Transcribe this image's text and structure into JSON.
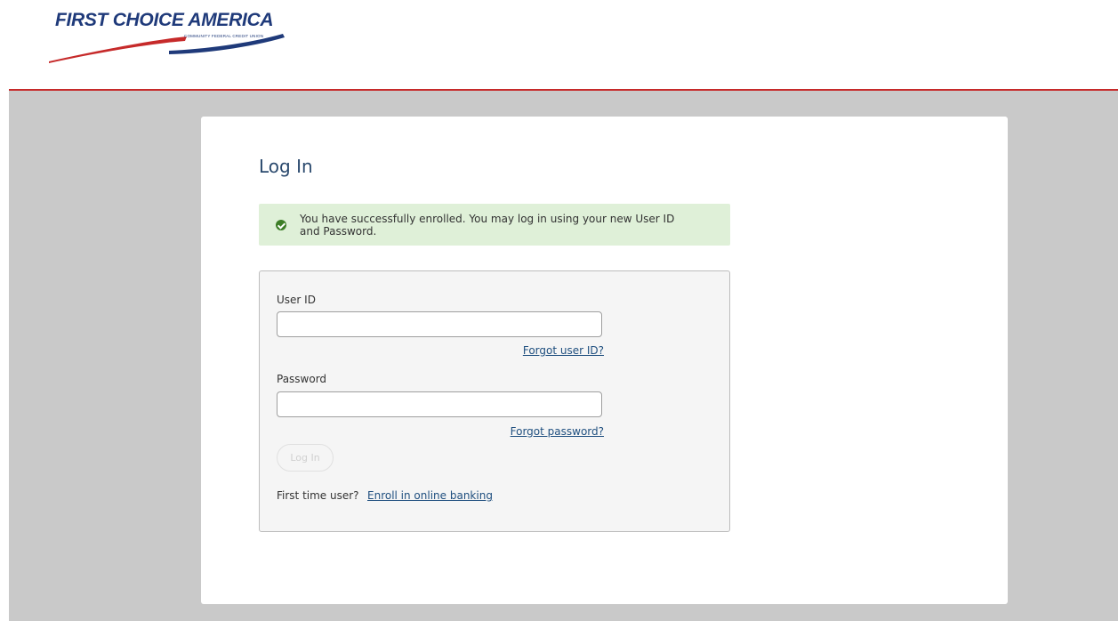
{
  "brand": {
    "name": "FIRST CHOICE AMERICA",
    "subtitle": "COMMUNITY FEDERAL CREDIT UNION",
    "colors": {
      "navy": "#1f3a7a",
      "red": "#c62a2a",
      "accent_blue": "#1f4f7f"
    }
  },
  "page": {
    "title": "Log In"
  },
  "alert": {
    "icon": "check-circle-icon",
    "message": "You have successfully enrolled. You may log in using your new User ID and Password.",
    "color": "#dff0d8"
  },
  "form": {
    "user_label": "User ID",
    "user_value": "",
    "forgot_user": "Forgot user ID?",
    "password_label": "Password",
    "password_value": "",
    "forgot_password": "Forgot password?",
    "login_button": "Log In",
    "first_time_text": "First time user?",
    "enroll_link": "Enroll in online banking"
  }
}
